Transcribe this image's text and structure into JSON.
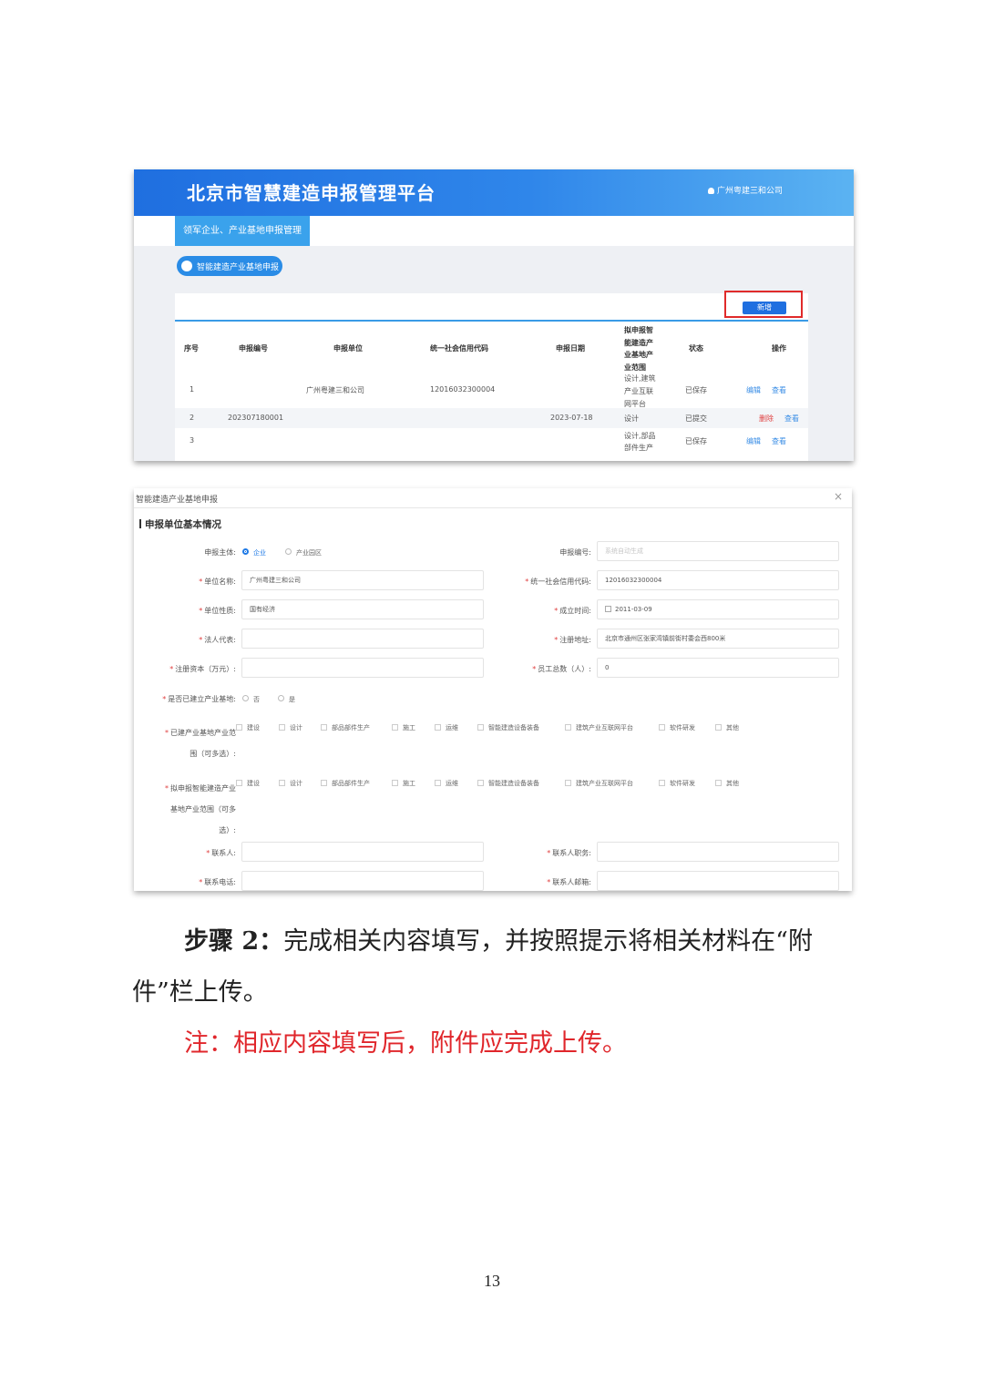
{
  "list_screen": {
    "platform_title": "北京市智慧建造申报管理平台",
    "user_name": "广州粤建三和公司",
    "nav_tab": "领军企业、产业基地申报管理",
    "section_pill": "智能建造产业基地申报",
    "add_button": "新增",
    "columns": [
      "序号",
      "申报编号",
      "申报单位",
      "统一社会信用代码",
      "申报日期",
      [
        "拟申报智",
        "能建造产",
        "业基地产",
        "业范围"
      ],
      "状态",
      "操作"
    ],
    "rows": [
      {
        "no": "1",
        "code": "",
        "unit": "广州粤建三和公司",
        "credit": "12016032300004",
        "date": "",
        "scope": [
          "设计,建筑",
          "产业互联",
          "网平台"
        ],
        "status": "已保存",
        "actions": [
          "编辑",
          "查看"
        ]
      },
      {
        "no": "2",
        "code": "202307180001",
        "unit": "",
        "credit": "",
        "date": "2023-07-18",
        "scope": [
          "设计"
        ],
        "status": "已提交",
        "actions": [
          "删除",
          "查看"
        ]
      },
      {
        "no": "3",
        "code": "",
        "unit": "",
        "credit": "",
        "date": "",
        "scope": [
          "设计,部品",
          "部件生产"
        ],
        "status": "已保存",
        "actions": [
          "编辑",
          "查看"
        ]
      }
    ]
  },
  "form_screen": {
    "dialog_title": "智能建造产业基地申报",
    "section_title": "申报单位基本情况",
    "subject_label": "申报主体:",
    "subject_options": [
      "企业",
      "产业园区"
    ],
    "code_label": "申报编号:",
    "code_placeholder": "系统自动生成",
    "unit_name_label": "单位名称:",
    "unit_name_value": "广州粤建三和公司",
    "credit_label": "统一社会信用代码:",
    "credit_value": "12016032300004",
    "nature_label": "单位性质:",
    "nature_value": "国有经济",
    "founded_label": "成立时间:",
    "founded_value": "2011-03-09",
    "legal_label": "法人代表:",
    "legal_value": "",
    "address_label": "注册地址:",
    "address_value": "北京市通州区张家湾镇前街村委会西800米",
    "capital_label": "注册资本（万元）:",
    "capital_value": "",
    "staff_label": "员工总数（人）:",
    "staff_value": "0",
    "built_label": "是否已建立产业基地:",
    "built_options": [
      "否",
      "是"
    ],
    "built_scope_label": [
      "已建产业基地产业范",
      "围（可多选）:"
    ],
    "plan_scope_label": [
      "拟申报智能建造产业",
      "基地产业范围（可多",
      "选）:"
    ],
    "scope_options": [
      "建设",
      "设计",
      "部品部件生产",
      "施工",
      "运维",
      "智能建造设备装备",
      "建筑产业互联网平台",
      "软件研发",
      "其他"
    ],
    "contact_label": "联系人:",
    "contact_title_label": "联系人职务:",
    "phone_label": "联系电话:",
    "email_label": "联系人邮箱:"
  },
  "instructions": {
    "step_label": "步骤 2：",
    "step_text_line1": "完成相关内容填写，并按照提示将相关材料在“附",
    "step_text_line2": "件”栏上传。",
    "note": "注：相应内容填写后，附件应完成上传。"
  },
  "page_number": "13"
}
